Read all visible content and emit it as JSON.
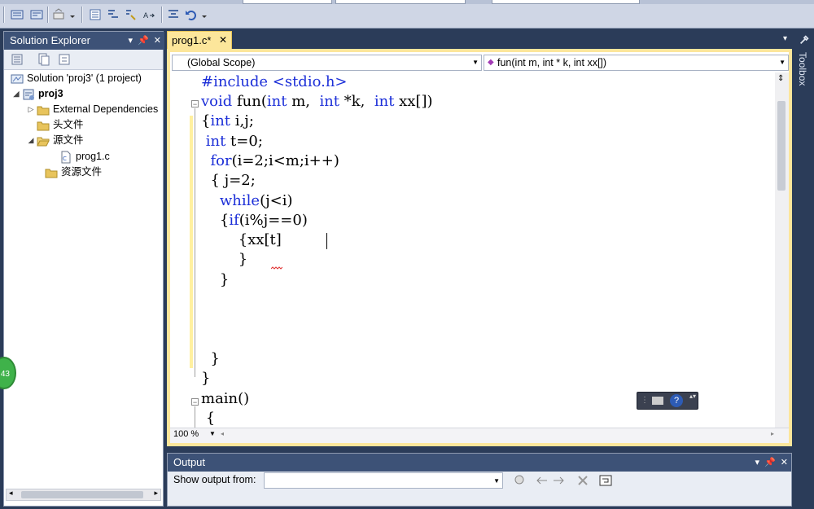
{
  "solution_explorer": {
    "title": "Solution Explorer",
    "solution_label": "Solution 'proj3' (1 project)",
    "project": "proj3",
    "ext_deps": "External Dependencies",
    "header_files": "头文件",
    "source_files": "源文件",
    "source_file": "prog1.c",
    "resource_files": "资源文件"
  },
  "editor": {
    "tab_label": "prog1.c*",
    "scope": "(Global Scope)",
    "function": "fun(int m, int * k, int xx[])",
    "zoom": "100 %",
    "code_lines": [
      "#include <stdio.h>",
      "void fun(int m,  int *k,  int xx[])",
      "{int i,j;",
      " int t=0;",
      "  for(i=2;i<m;i++)",
      "  { j=2;",
      "    while(j<i)",
      "    {if(i%j==0)",
      "        {xx[t]",
      "        }",
      "    }",
      "",
      "",
      "",
      "  }",
      "}",
      "main()",
      " {"
    ]
  },
  "output": {
    "title": "Output",
    "show_from_label": "Show output from:",
    "show_from_value": ""
  },
  "toolbox": {
    "label": "Toolbox"
  },
  "badge": {
    "value": "43"
  },
  "colors": {
    "titlebar": "#3d5277",
    "tab_active": "#fce69b",
    "keyword": "#1c2fd8",
    "background": "#2b3c59"
  }
}
